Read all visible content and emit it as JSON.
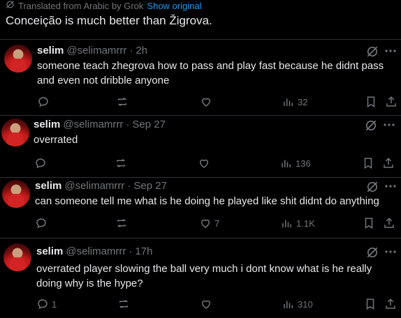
{
  "translation": {
    "label": "Translated from Arabic by Grok",
    "show_original": "Show original"
  },
  "post_text": "Conceição is much better than Žigrova.",
  "replies": [
    {
      "name": "selim",
      "handle": "@selimamrrr",
      "time": "2h",
      "text": "someone teach zhegrova how to pass and play fast because he didnt pass and even not dribble anyone",
      "reply_count": "",
      "repost_count": "",
      "like_count": "",
      "view_count": "32"
    },
    {
      "name": "selim",
      "handle": "@selimamrrr",
      "time": "Sep 27",
      "text": "overrated",
      "reply_count": "",
      "repost_count": "",
      "like_count": "",
      "view_count": "136"
    },
    {
      "name": "selim",
      "handle": "@selimamrrr",
      "time": "Sep 27",
      "text": "can someone tell me what is he doing he played like shit didnt do anything",
      "reply_count": "",
      "repost_count": "",
      "like_count": "7",
      "view_count": "1.1K"
    },
    {
      "name": "selim",
      "handle": "@selimamrrr",
      "time": "17h",
      "text": "overrated player slowing the ball very much i dont know what is he really doing why is the hype?",
      "reply_count": "1",
      "repost_count": "",
      "like_count": "",
      "view_count": "310"
    }
  ],
  "header_dot": "·"
}
